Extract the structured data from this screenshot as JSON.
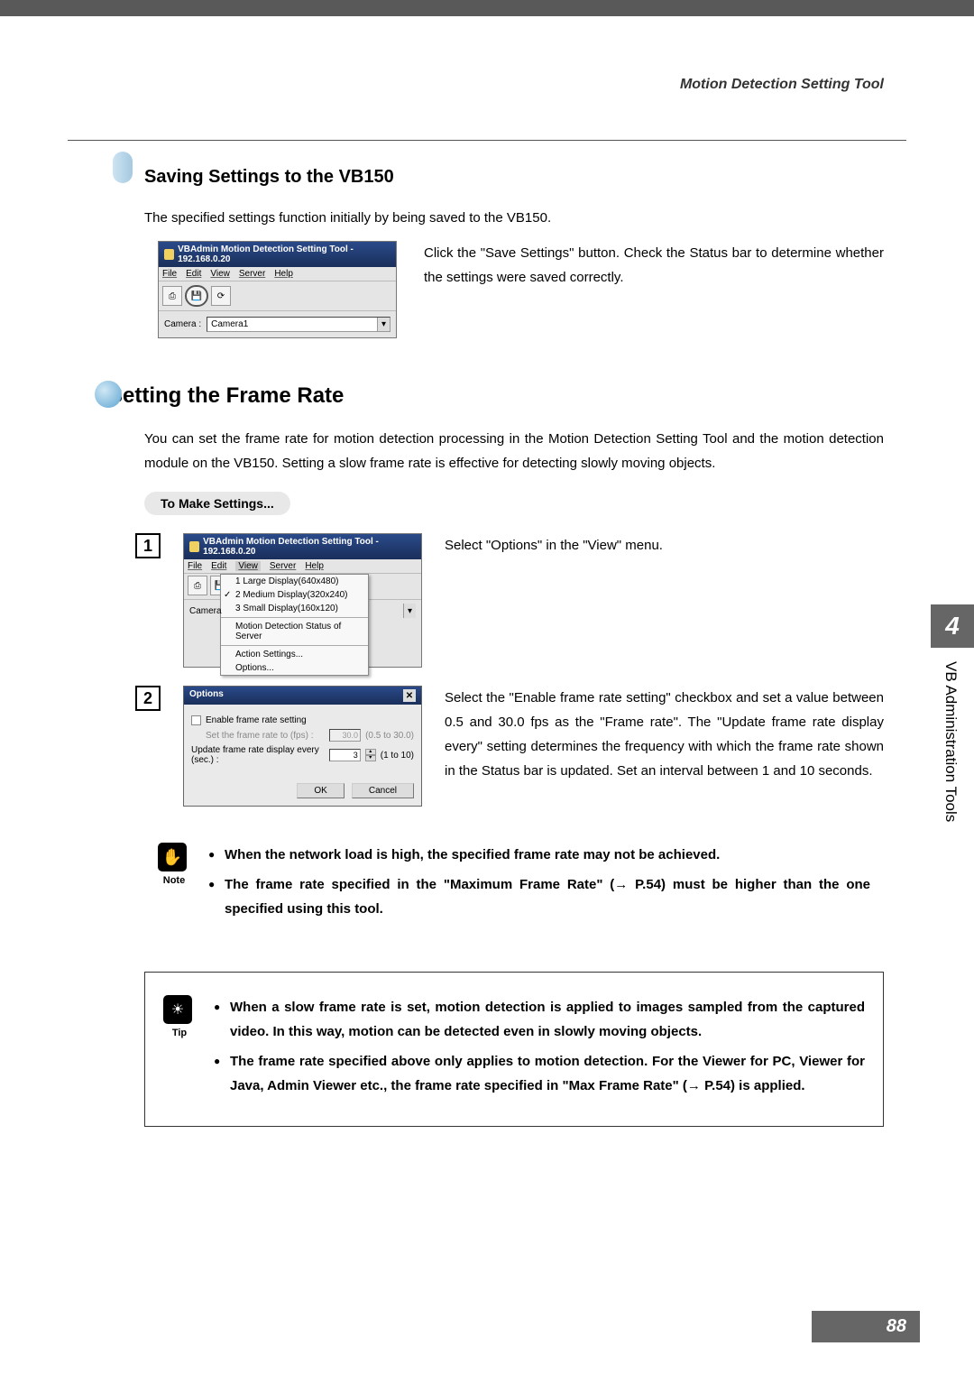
{
  "header": {
    "title": "Motion Detection Setting Tool"
  },
  "section1": {
    "heading": "Saving Settings to the VB150",
    "intro": "The specified settings function initially by being saved to the VB150.",
    "window": {
      "title": "VBAdmin Motion Detection Setting Tool - 192.168.0.20",
      "menu": {
        "file": "File",
        "edit": "Edit",
        "view": "View",
        "server": "Server",
        "help": "Help"
      },
      "camera_label": "Camera :",
      "camera_value": "Camera1"
    },
    "desc": "Click the \"Save Settings\" button. Check the Status bar to determine whether the settings were saved correctly."
  },
  "section2": {
    "heading": "Setting the Frame Rate",
    "intro": "You can set the frame rate for motion detection processing in the Motion Detection Setting Tool and the motion detection module on the VB150. Setting a slow frame rate is effective for detecting slowly moving objects.",
    "pill": "To Make Settings...",
    "step1": {
      "num": "1",
      "text": "Select \"Options\" in the \"View\" menu.",
      "window_title": "VBAdmin Motion Detection Setting Tool - 192.168.0.20",
      "menu": {
        "file": "File",
        "edit": "Edit",
        "view": "View",
        "server": "Server",
        "help": "Help"
      },
      "camera_label": "Camera",
      "dd": {
        "i1": "1 Large Display(640x480)",
        "i2": "2 Medium Display(320x240)",
        "i3": "3 Small Display(160x120)",
        "i4": "Motion Detection Status of Server",
        "i5": "Action Settings...",
        "i6": "Options..."
      }
    },
    "step2": {
      "num": "2",
      "text": "Select the \"Enable frame rate setting\" checkbox and set a value between 0.5 and 30.0 fps as the \"Frame rate\". The \"Update frame rate display every\" setting determines the frequency with which the frame rate shown in the Status bar is updated. Set an interval between 1 and 10 seconds.",
      "dialog": {
        "title": "Options",
        "cb_label": "Enable frame rate setting",
        "row1_label": "Set the frame rate to (fps) :",
        "row1_val": "30.0",
        "row1_hint": "(0.5 to 30.0)",
        "row2_label": "Update frame rate display every (sec.) :",
        "row2_val": "3",
        "row2_hint": "(1 to 10)",
        "ok": "OK",
        "cancel": "Cancel"
      }
    }
  },
  "note": {
    "label": "Note",
    "b1": "When the network load is high, the specified frame rate may not be achieved.",
    "b2_pre": "The frame rate specified in the \"Maximum Frame Rate\" (",
    "b2_post": " P.54) must be higher than the one specified using this tool."
  },
  "tip": {
    "label": "Tip",
    "b1": "When a slow frame rate is set, motion detection is applied to images sampled from the captured video. In this way, motion can be detected even in slowly moving objects.",
    "b2_pre": "The frame rate specified above only applies to motion detection. For the Viewer for PC, Viewer for Java, Admin Viewer etc., the frame rate specified in \"Max Frame Rate\" (",
    "b2_post": " P.54) is applied."
  },
  "sidetab": {
    "num": "4",
    "text": "VB Administration Tools"
  },
  "page": "88",
  "arrow": "→"
}
